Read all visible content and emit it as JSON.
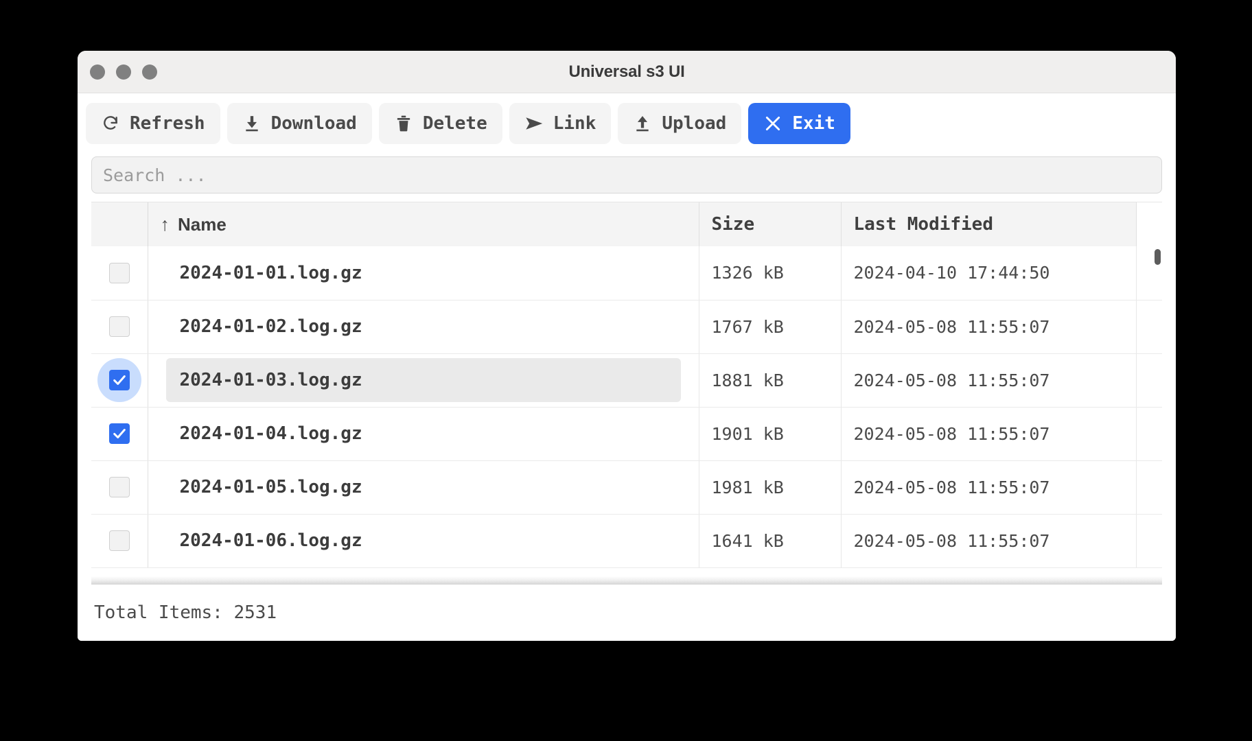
{
  "window": {
    "title": "Universal s3 UI",
    "traffic_lights": [
      "close",
      "minimize",
      "maximize"
    ]
  },
  "toolbar": {
    "buttons": [
      {
        "label": "Refresh",
        "icon": "refresh-icon",
        "primary": false
      },
      {
        "label": "Download",
        "icon": "download-icon",
        "primary": false
      },
      {
        "label": "Delete",
        "icon": "trash-icon",
        "primary": false
      },
      {
        "label": "Link",
        "icon": "send-icon",
        "primary": false
      },
      {
        "label": "Upload",
        "icon": "upload-icon",
        "primary": false
      },
      {
        "label": "Exit",
        "icon": "close-x-icon",
        "primary": true
      }
    ],
    "primary_color": "#2f6ef0"
  },
  "search": {
    "value": "",
    "placeholder": "Search ..."
  },
  "table": {
    "sort_column": "Name",
    "sort_direction": "ascending",
    "sort_indicator": "↑",
    "columns": [
      {
        "key": "check",
        "label": ""
      },
      {
        "key": "name",
        "label": "Name"
      },
      {
        "key": "size",
        "label": "Size"
      },
      {
        "key": "modified",
        "label": "Last Modified"
      }
    ],
    "rows": [
      {
        "name": "2024-01-01.log.gz",
        "size": "1326 kB",
        "modified": "2024-04-10 17:44:50",
        "checked": false,
        "current": false
      },
      {
        "name": "2024-01-02.log.gz",
        "size": "1767 kB",
        "modified": "2024-05-08 11:55:07",
        "checked": false,
        "current": false
      },
      {
        "name": "2024-01-03.log.gz",
        "size": "1881 kB",
        "modified": "2024-05-08 11:55:07",
        "checked": true,
        "current": true
      },
      {
        "name": "2024-01-04.log.gz",
        "size": "1901 kB",
        "modified": "2024-05-08 11:55:07",
        "checked": true,
        "current": false
      },
      {
        "name": "2024-01-05.log.gz",
        "size": "1981 kB",
        "modified": "2024-05-08 11:55:07",
        "checked": false,
        "current": false
      },
      {
        "name": "2024-01-06.log.gz",
        "size": "1641 kB",
        "modified": "2024-05-08 11:55:07",
        "checked": false,
        "current": false
      }
    ]
  },
  "footer": {
    "total_items": "Total Items: 2531"
  }
}
